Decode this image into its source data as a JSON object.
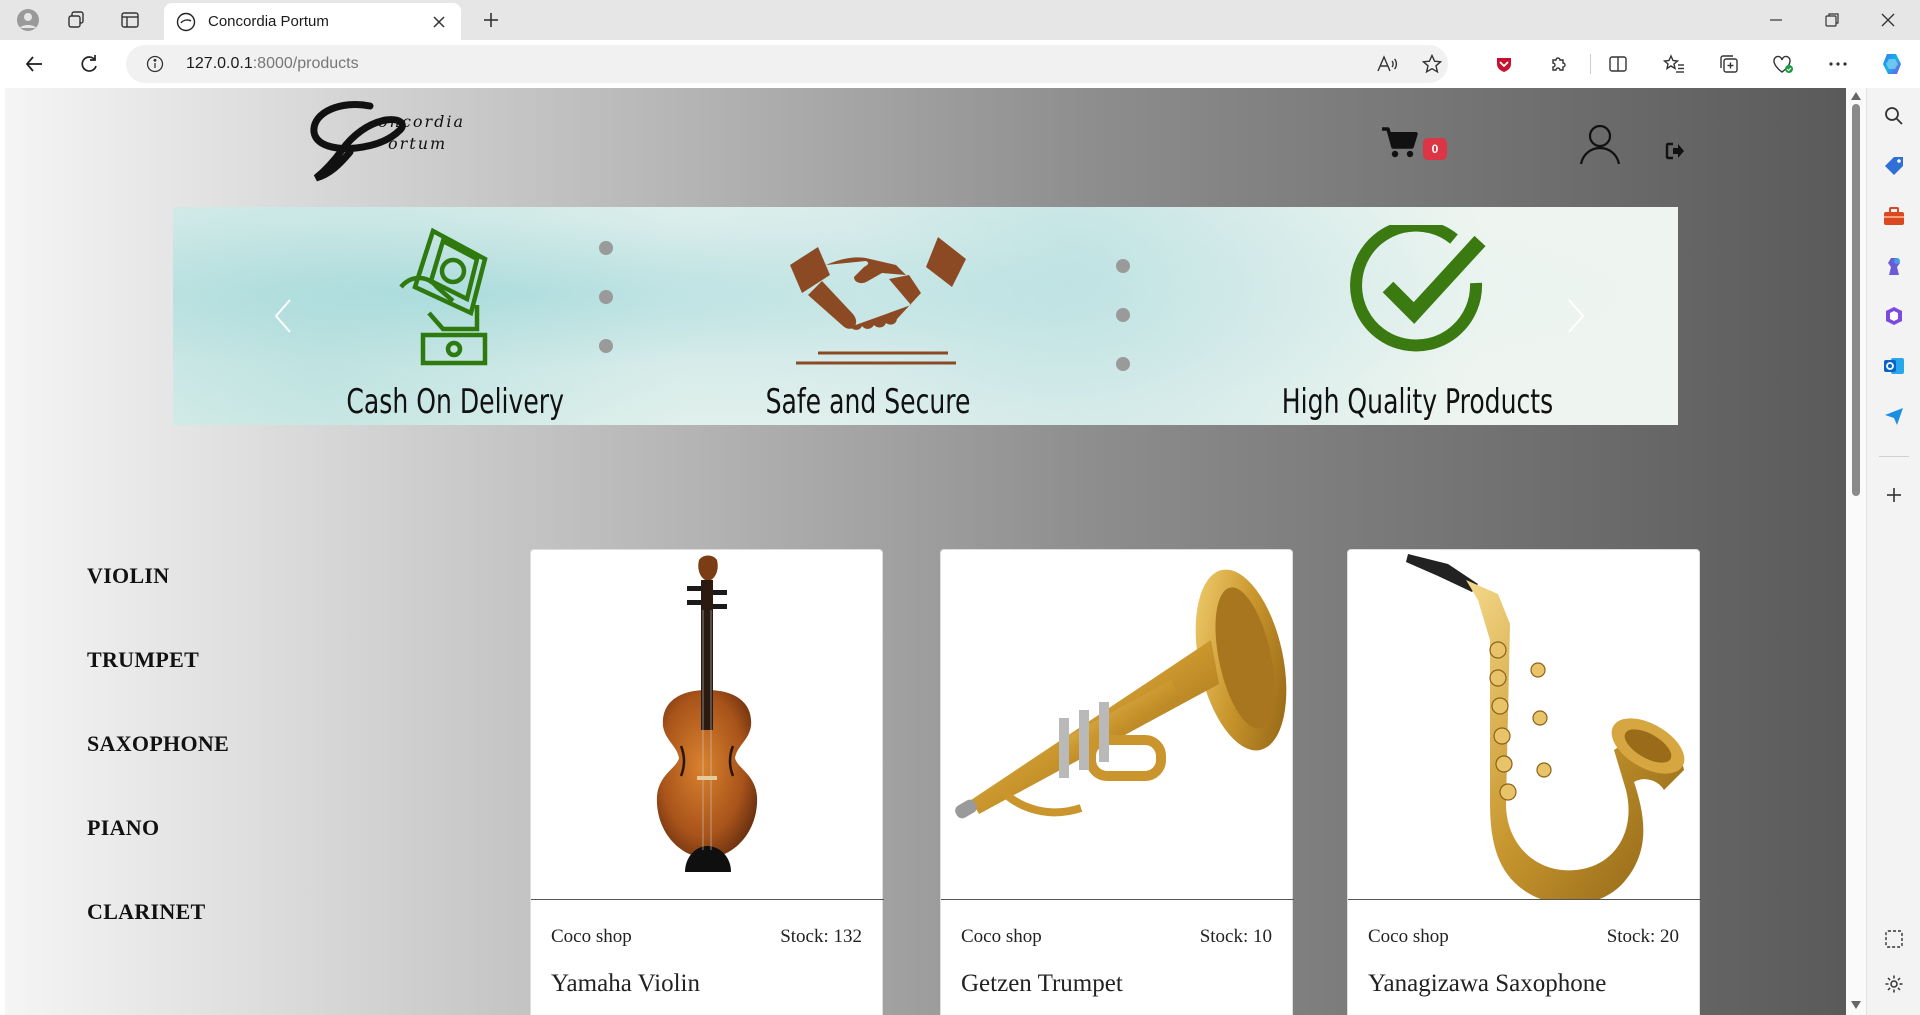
{
  "browser": {
    "tab_title": "Concordia Portum",
    "url_host": "127.0.0.1",
    "url_path": ":8000/products"
  },
  "header": {
    "logo_line1": "oncordia",
    "logo_line2": "ortum",
    "cart_count": "0"
  },
  "banner": {
    "features": [
      {
        "label": "Cash On Delivery",
        "icon": "cash-delivery-icon",
        "color": "#2f7a0f"
      },
      {
        "label": "Safe and Secure",
        "icon": "handshake-icon",
        "color": "#8b4a23"
      },
      {
        "label": "High Quality Products",
        "icon": "checkmark-icon",
        "color": "#3a7a10"
      }
    ]
  },
  "categories": [
    "VIOLIN",
    "TRUMPET",
    "SAXOPHONE",
    "PIANO",
    "CLARINET"
  ],
  "products": [
    {
      "shop": "Coco shop",
      "stock_label": "Stock:",
      "stock": "132",
      "name": "Yamaha Violin",
      "image": "violin"
    },
    {
      "shop": "Coco shop",
      "stock_label": "Stock:",
      "stock": "10",
      "name": "Getzen Trumpet",
      "image": "trumpet"
    },
    {
      "shop": "Coco shop",
      "stock_label": "Stock:",
      "stock": "20",
      "name": "Yanagizawa Saxophone",
      "image": "saxophone"
    }
  ]
}
